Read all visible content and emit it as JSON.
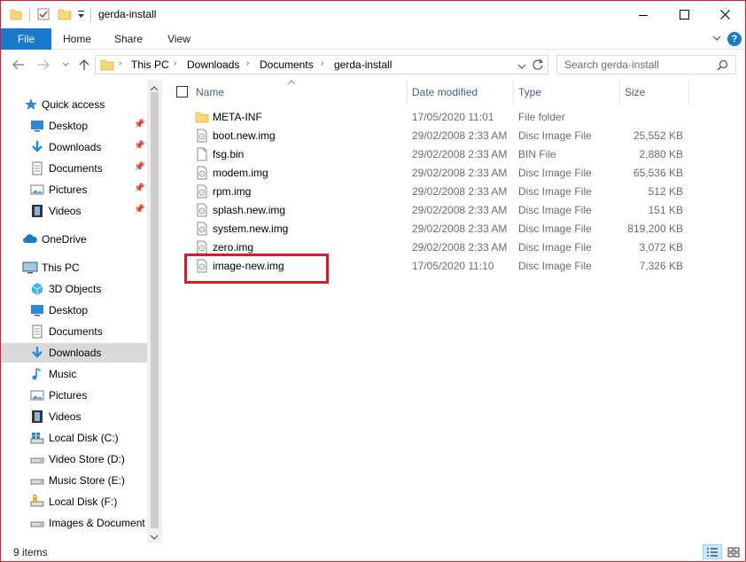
{
  "window": {
    "title": "gerda-install"
  },
  "ribbon": {
    "tabs": [
      "File",
      "Home",
      "Share",
      "View"
    ],
    "help": "?"
  },
  "address": {
    "crumbs": [
      "This PC",
      "Downloads",
      "Documents",
      "gerda-install"
    ]
  },
  "search": {
    "placeholder": "Search gerda-install"
  },
  "nav": {
    "quick_access": "Quick access",
    "quick_items": [
      {
        "label": "Desktop",
        "icon": "desktop-icon"
      },
      {
        "label": "Downloads",
        "icon": "downloads-icon"
      },
      {
        "label": "Documents",
        "icon": "documents-icon"
      },
      {
        "label": "Pictures",
        "icon": "pictures-icon"
      },
      {
        "label": "Videos",
        "icon": "videos-icon"
      }
    ],
    "onedrive": "OneDrive",
    "this_pc": "This PC",
    "pc_items": [
      {
        "label": "3D Objects",
        "icon": "3d-objects-icon"
      },
      {
        "label": "Desktop",
        "icon": "desktop-icon"
      },
      {
        "label": "Documents",
        "icon": "documents-icon"
      },
      {
        "label": "Downloads",
        "icon": "downloads-icon",
        "selected": true
      },
      {
        "label": "Music",
        "icon": "music-icon"
      },
      {
        "label": "Pictures",
        "icon": "pictures-icon"
      },
      {
        "label": "Videos",
        "icon": "videos-icon"
      },
      {
        "label": "Local Disk (C:)",
        "icon": "windows-drive-icon"
      },
      {
        "label": "Video Store (D:)",
        "icon": "drive-icon"
      },
      {
        "label": "Music Store (E:)",
        "icon": "drive-icon"
      },
      {
        "label": "Local Disk (F:)",
        "icon": "locked-drive-icon"
      },
      {
        "label": "Images & Document",
        "icon": "drive-icon"
      }
    ]
  },
  "columns": {
    "name": "Name",
    "date": "Date modified",
    "type": "Type",
    "size": "Size"
  },
  "files": [
    {
      "name": "META-INF",
      "date": "17/05/2020 11:01",
      "type": "File folder",
      "size": "",
      "icon": "folder-icon"
    },
    {
      "name": "boot.new.img",
      "date": "29/02/2008 2:33 AM",
      "type": "Disc Image File",
      "size": "25,552 KB",
      "icon": "disc-image-icon"
    },
    {
      "name": "fsg.bin",
      "date": "29/02/2008 2:33 AM",
      "type": "BIN File",
      "size": "2,880 KB",
      "icon": "file-icon"
    },
    {
      "name": "modem.img",
      "date": "29/02/2008 2:33 AM",
      "type": "Disc Image File",
      "size": "65,536 KB",
      "icon": "disc-image-icon"
    },
    {
      "name": "rpm.img",
      "date": "29/02/2008 2:33 AM",
      "type": "Disc Image File",
      "size": "512 KB",
      "icon": "disc-image-icon"
    },
    {
      "name": "splash.new.img",
      "date": "29/02/2008 2:33 AM",
      "type": "Disc Image File",
      "size": "151 KB",
      "icon": "disc-image-icon"
    },
    {
      "name": "system.new.img",
      "date": "29/02/2008 2:33 AM",
      "type": "Disc Image File",
      "size": "819,200 KB",
      "icon": "disc-image-icon"
    },
    {
      "name": "zero.img",
      "date": "29/02/2008 2:33 AM",
      "type": "Disc Image File",
      "size": "3,072 KB",
      "icon": "disc-image-icon"
    },
    {
      "name": "image-new.img",
      "date": "17/05/2020 11:10",
      "type": "Disc Image File",
      "size": "7,326 KB",
      "icon": "disc-image-icon",
      "highlighted": true
    }
  ],
  "status": {
    "items": "9 items"
  },
  "colors": {
    "accent": "#1979ca",
    "highlight": "#d31f2a",
    "selected_nav": "#d9d9d9"
  }
}
